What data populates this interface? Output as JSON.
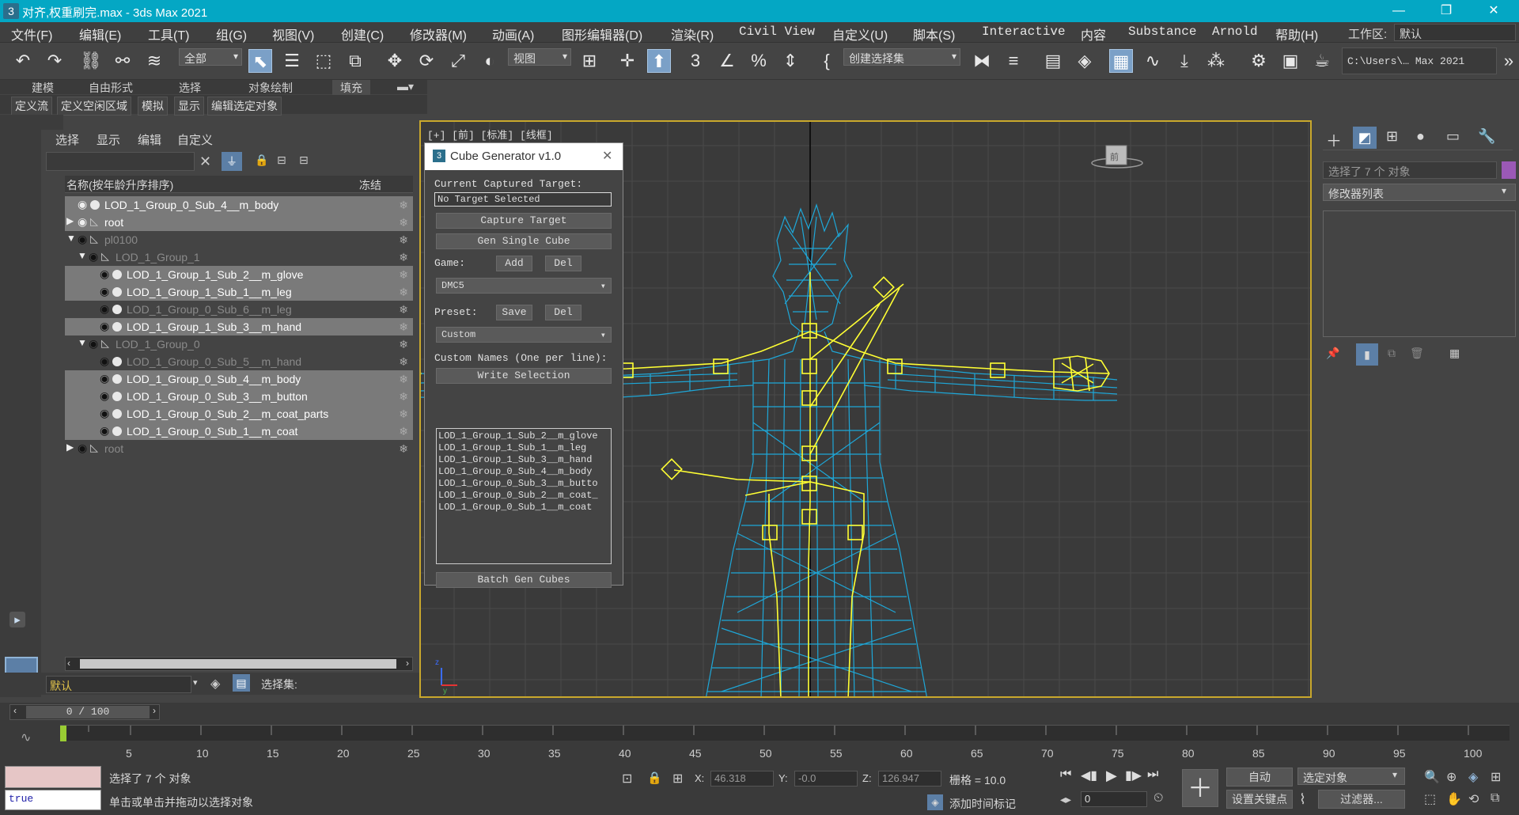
{
  "app": {
    "title": "对齐,权重刷完.max - 3ds Max 2021",
    "icon_label": "3",
    "window_controls": [
      "—",
      "❐",
      "✕"
    ]
  },
  "menu": {
    "items": [
      "文件(F)",
      "编辑(E)",
      "工具(T)",
      "组(G)",
      "视图(V)",
      "创建(C)",
      "修改器(M)",
      "动画(A)",
      "图形编辑器(D)",
      "渲染(R)",
      "Civil View",
      "自定义(U)",
      "脚本(S)",
      "Interactive",
      "内容",
      "Substance",
      "Arnold",
      "帮助(H)"
    ],
    "workspace_label": "工作区:",
    "workspace_value": "默认"
  },
  "toolbar": {
    "filter_dropdown": "全部",
    "view_dropdown": "视图",
    "selection_set_dropdown": "创建选择集",
    "project_path": "C:\\Users\\… Max 2021"
  },
  "ribbon": {
    "tabs": [
      "建模",
      "自由形式",
      "选择",
      "对象绘制",
      "填充"
    ],
    "subtabs": [
      "定义流",
      "定义空闲区域",
      "模拟",
      "显示",
      "编辑选定对象"
    ]
  },
  "scene_explorer": {
    "menus": [
      "选择",
      "显示",
      "编辑",
      "自定义"
    ],
    "col_name": "名称(按年龄升序排序)",
    "col_freeze": "冻结",
    "rows": [
      {
        "name": "LOD_1_Group_0_Sub_4__m_body",
        "style": "hl"
      },
      {
        "name": "root",
        "style": "hl"
      },
      {
        "name": "pl0100",
        "style": "dim"
      },
      {
        "name": "LOD_1_Group_1",
        "style": "dim"
      },
      {
        "name": "LOD_1_Group_1_Sub_2__m_glove",
        "style": "hl"
      },
      {
        "name": "LOD_1_Group_1_Sub_1__m_leg",
        "style": "hl"
      },
      {
        "name": "LOD_1_Group_0_Sub_6__m_leg",
        "style": "dim"
      },
      {
        "name": "LOD_1_Group_1_Sub_3__m_hand",
        "style": "hl"
      },
      {
        "name": "LOD_1_Group_0",
        "style": "dim"
      },
      {
        "name": "LOD_1_Group_0_Sub_5__m_hand",
        "style": "dim"
      },
      {
        "name": "LOD_1_Group_0_Sub_4__m_body",
        "style": "hl"
      },
      {
        "name": "LOD_1_Group_0_Sub_3__m_button",
        "style": "hl"
      },
      {
        "name": "LOD_1_Group_0_Sub_2__m_coat_parts",
        "style": "hl"
      },
      {
        "name": "LOD_1_Group_0_Sub_1__m_coat",
        "style": "hl"
      },
      {
        "name": "root",
        "style": "dim"
      }
    ],
    "layer_value": "默认",
    "selection_set_label": "选择集:"
  },
  "viewport": {
    "label": "[+] [前] [标准] [线框]"
  },
  "dialog": {
    "title": "Cube Generator v1.0",
    "current_target_label": "Current Captured Target:",
    "target_value": "No Target Selected",
    "capture_btn": "Capture Target",
    "gen_single_btn": "Gen Single Cube",
    "game_label": "Game:",
    "add_btn": "Add",
    "del_btn": "Del",
    "game_value": "DMC5",
    "preset_label": "Preset:",
    "save_btn": "Save",
    "preset_del_btn": "Del",
    "preset_value": "Custom",
    "custom_names_label": "Custom Names (One per line):",
    "write_btn": "Write Selection",
    "names_text": "LOD_1_Group_1_Sub_2__m_glove\nLOD_1_Group_1_Sub_1__m_leg\nLOD_1_Group_1_Sub_3__m_hand\nLOD_1_Group_0_Sub_4__m_body\nLOD_1_Group_0_Sub_3__m_butto\nLOD_1_Group_0_Sub_2__m_coat_\nLOD_1_Group_0_Sub_1__m_coat",
    "batch_btn": "Batch Gen Cubes"
  },
  "command_panel": {
    "selected_text": "选择了 7 个 对象",
    "modifier_list": "修改器列表"
  },
  "timeline": {
    "frame_display": "0 / 100",
    "ticks": [
      "5",
      "10",
      "15",
      "20",
      "25",
      "30",
      "35",
      "40",
      "45",
      "50",
      "55",
      "60",
      "65",
      "70",
      "75",
      "80",
      "85",
      "90",
      "95",
      "100"
    ]
  },
  "status": {
    "script_output": "true",
    "selected": "选择了 7 个 对象",
    "prompt": "单击或单击并拖动以选择对象",
    "x_label": "X:",
    "x_value": "46.318",
    "y_label": "Y:",
    "y_value": "-0.0",
    "z_label": "Z:",
    "z_value": "126.947",
    "grid": "栅格 = 10.0",
    "add_time_tag": "添加时间标记",
    "auto_btn": "自动",
    "set_key_btn": "设置关键点",
    "selected_object_dd": "选定对象",
    "filters_btn": "过滤器...",
    "frame_field": "0"
  },
  "colors": {
    "titlebar": "#04a7c4",
    "wire": "#1ea7d8",
    "bones": "#ffff33",
    "viewport_border": "#c9a82c",
    "active_tool": "#7ba0c7"
  }
}
